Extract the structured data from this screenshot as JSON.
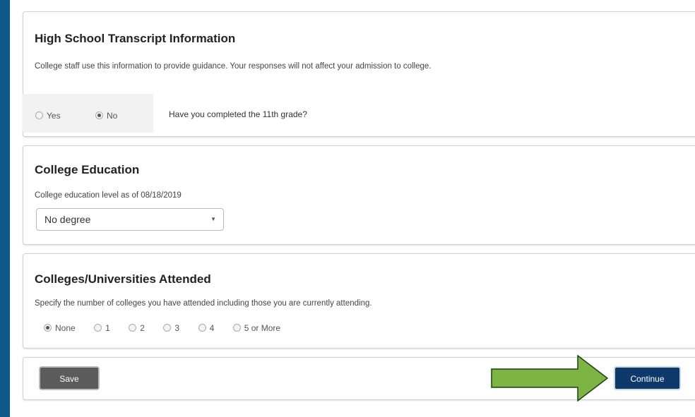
{
  "transcript": {
    "title": "High School Transcript Information",
    "description": "College staff use this information to provide guidance. Your responses will not affect your admission to college.",
    "options": [
      {
        "label": "Yes",
        "checked": false
      },
      {
        "label": "No",
        "checked": true
      }
    ],
    "question": "Have you completed the 11th grade?"
  },
  "education": {
    "title": "College Education",
    "label": "College education level as of 08/18/2019",
    "selected": "No degree"
  },
  "colleges": {
    "title": "Colleges/Universities Attended",
    "description": "Specify the number of colleges you have attended including those you are currently attending.",
    "options": [
      {
        "label": "None",
        "checked": true
      },
      {
        "label": "1",
        "checked": false
      },
      {
        "label": "2",
        "checked": false
      },
      {
        "label": "3",
        "checked": false
      },
      {
        "label": "4",
        "checked": false
      },
      {
        "label": "5 or More",
        "checked": false
      }
    ]
  },
  "actions": {
    "save_label": "Save",
    "continue_label": "Continue"
  },
  "colors": {
    "frame": "#0d5a8a",
    "continue": "#0e3a6b",
    "save": "#5b5b5b",
    "arrow": "#7cb342"
  },
  "icons": {
    "dropdown": "caret-down-icon",
    "pointer": "green-arrow-icon"
  }
}
